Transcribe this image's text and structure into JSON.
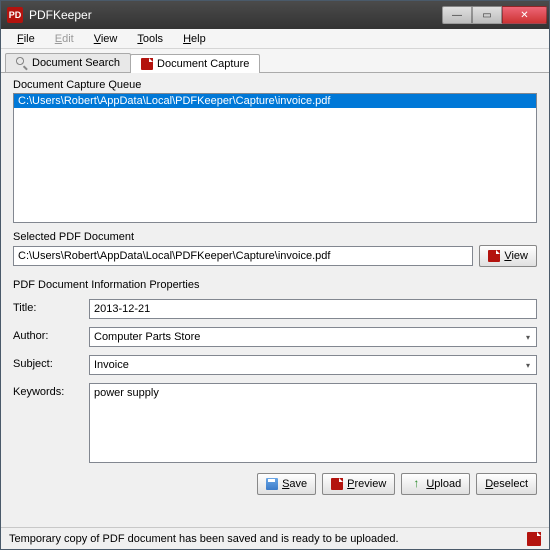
{
  "window": {
    "title": "PDFKeeper",
    "icon_label": "PD"
  },
  "menubar": {
    "file": "File",
    "edit": "Edit",
    "view": "View",
    "tools": "Tools",
    "help": "Help"
  },
  "tabs": {
    "search": "Document Search",
    "capture": "Document Capture"
  },
  "queue": {
    "label": "Document Capture Queue",
    "items": [
      "C:\\Users\\Robert\\AppData\\Local\\PDFKeeper\\Capture\\invoice.pdf"
    ]
  },
  "selected": {
    "label": "Selected PDF Document",
    "value": "C:\\Users\\Robert\\AppData\\Local\\PDFKeeper\\Capture\\invoice.pdf",
    "view_btn": "View"
  },
  "info": {
    "section": "PDF Document Information Properties",
    "title_label": "Title:",
    "title_value": "2013-12-21",
    "author_label": "Author:",
    "author_value": "Computer Parts Store",
    "subject_label": "Subject:",
    "subject_value": "Invoice",
    "keywords_label": "Keywords:",
    "keywords_value": "power supply"
  },
  "buttons": {
    "save": "Save",
    "preview": "Preview",
    "upload": "Upload",
    "deselect": "Deselect"
  },
  "status": {
    "text": "Temporary copy of PDF document has been saved and is ready to be uploaded."
  }
}
